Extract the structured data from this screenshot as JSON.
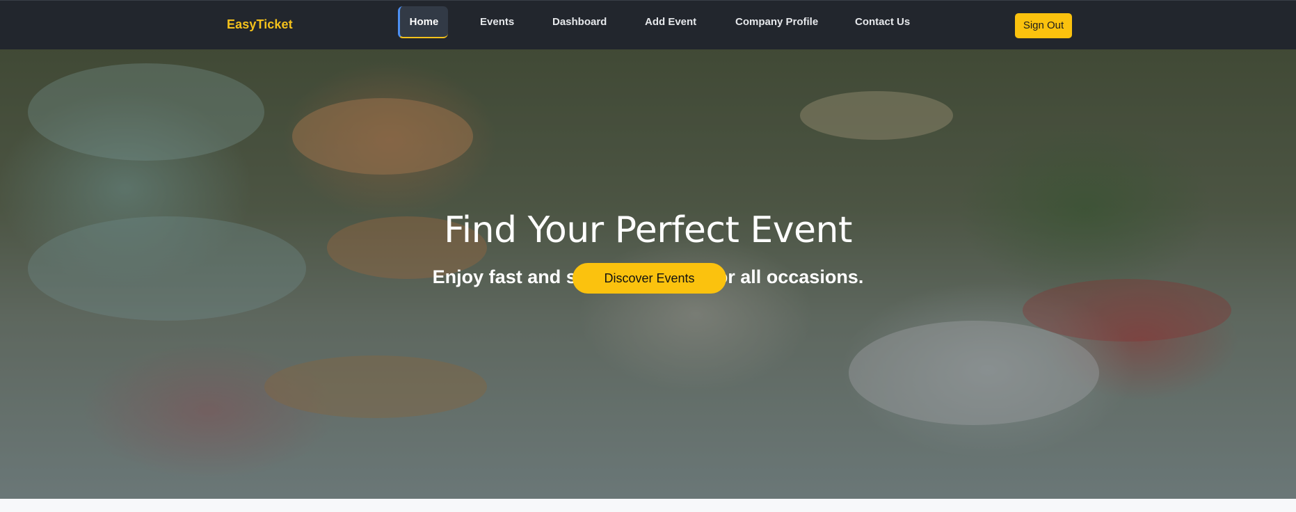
{
  "navbar": {
    "brand": "EasyTicket",
    "links": [
      {
        "label": "Home",
        "active": true
      },
      {
        "label": "Events",
        "active": false
      },
      {
        "label": "Dashboard",
        "active": false
      },
      {
        "label": "Add Event",
        "active": false
      },
      {
        "label": "Company Profile",
        "active": false
      },
      {
        "label": "Contact Us",
        "active": false
      }
    ],
    "signout_label": "Sign Out"
  },
  "hero": {
    "title": "Find Your Perfect Event",
    "subtitle": "Enjoy fast and secure booking for all occasions.",
    "cta_label": "Discover Events"
  },
  "colors": {
    "navbar_bg": "#22262d",
    "brand": "#f5c21b",
    "accent": "#fbc20e",
    "active_indicator": "#4d8ff2"
  }
}
